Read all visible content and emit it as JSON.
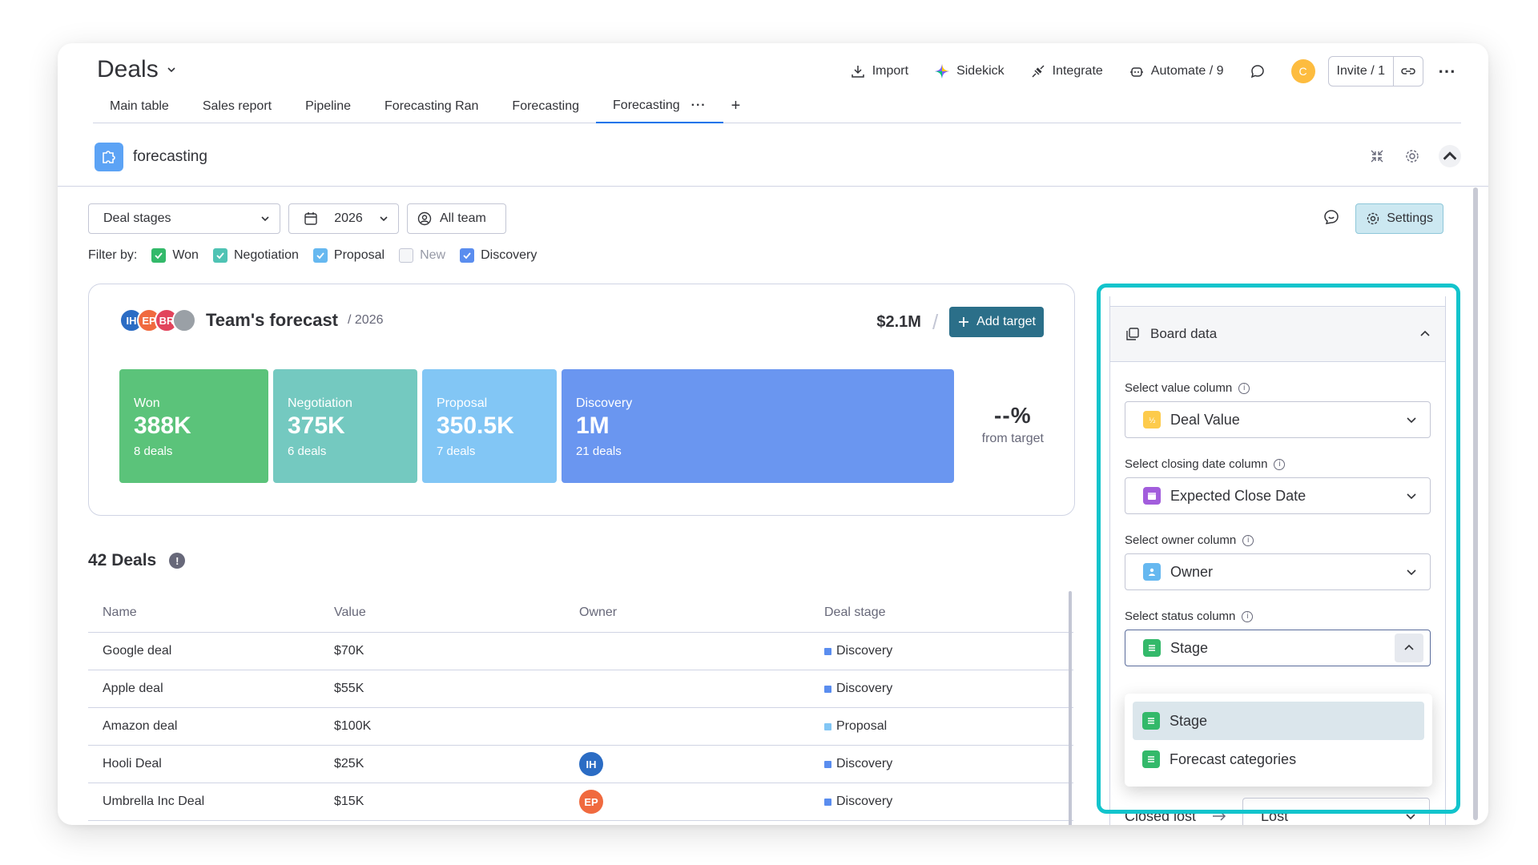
{
  "header": {
    "board_title": "Deals",
    "actions": [
      {
        "label": "Import",
        "icon": "import-icon"
      },
      {
        "label": "Sidekick",
        "icon": "sidekick-icon"
      },
      {
        "label": "Integrate",
        "icon": "integrate-icon"
      },
      {
        "label": "Automate / 9",
        "icon": "automate-icon"
      }
    ],
    "avatar_initial": "C",
    "invite_label": "Invite / 1"
  },
  "tabs": [
    {
      "label": "Main table"
    },
    {
      "label": "Sales report"
    },
    {
      "label": "Pipeline"
    },
    {
      "label": "Forecasting Ran"
    },
    {
      "label": "Forecasting"
    },
    {
      "label": "Forecasting",
      "active": true
    }
  ],
  "widget": {
    "title": "forecasting"
  },
  "filters": {
    "stages_label": "Deal stages",
    "year_label": "2026",
    "team_label": "All team",
    "settings_label": "Settings",
    "filter_by_label": "Filter by:",
    "checks": [
      {
        "label": "Won",
        "checked": true,
        "color": "#33b96a"
      },
      {
        "label": "Negotiation",
        "checked": true,
        "color": "#4fc3b4"
      },
      {
        "label": "Proposal",
        "checked": true,
        "color": "#66b8f0"
      },
      {
        "label": "New",
        "checked": false,
        "color": "#c3c6d4"
      },
      {
        "label": "Discovery",
        "checked": true,
        "color": "#5a8def"
      }
    ]
  },
  "forecast": {
    "title": "Team's forecast",
    "year": "/ 2026",
    "total": "$2.1M",
    "add_target_label": "Add target",
    "avatars": [
      {
        "initials": "IH",
        "color": "#2b6cc4"
      },
      {
        "initials": "EP",
        "color": "#f06a3f"
      },
      {
        "initials": "BR",
        "color": "#e2445c"
      },
      {
        "initials": "",
        "color": "#9aa0a6"
      }
    ],
    "bars": [
      {
        "label": "Won",
        "value": "388K",
        "deals": "8 deals",
        "color": "#5bc37a",
        "width": 150
      },
      {
        "label": "Negotiation",
        "value": "375K",
        "deals": "6 deals",
        "color": "#74c9c0",
        "width": 145
      },
      {
        "label": "Proposal",
        "value": "350.5K",
        "deals": "7 deals",
        "color": "#82c6f5",
        "width": 135
      },
      {
        "label": "Discovery",
        "value": "1M",
        "deals": "21 deals",
        "color": "#6a96f0",
        "width": 397
      }
    ],
    "pct_value": "--%",
    "pct_label": "from target"
  },
  "deals": {
    "title": "42 Deals",
    "columns": [
      "Name",
      "Value",
      "Owner",
      "Deal stage"
    ],
    "rows": [
      {
        "name": "Google deal",
        "value": "$70K",
        "owner": "",
        "owner_color": "",
        "stage": "Discovery",
        "stage_color": "#5a8def"
      },
      {
        "name": "Apple deal",
        "value": "$55K",
        "owner": "",
        "owner_color": "",
        "stage": "Discovery",
        "stage_color": "#5a8def"
      },
      {
        "name": "Amazon deal",
        "value": "$100K",
        "owner": "",
        "owner_color": "",
        "stage": "Proposal",
        "stage_color": "#82c6f5"
      },
      {
        "name": "Hooli Deal",
        "value": "$25K",
        "owner": "IH",
        "owner_color": "#2b6cc4",
        "stage": "Discovery",
        "stage_color": "#5a8def"
      },
      {
        "name": "Umbrella Inc Deal",
        "value": "$15K",
        "owner": "EP",
        "owner_color": "#f06a3f",
        "stage": "Discovery",
        "stage_color": "#5a8def"
      }
    ]
  },
  "settings_panel": {
    "section_title": "Board data",
    "value_label": "Select value column",
    "value_selected": "Deal Value",
    "date_label": "Select closing date column",
    "date_selected": "Expected Close Date",
    "owner_label": "Select owner column",
    "owner_selected": "Owner",
    "status_label": "Select status column",
    "status_selected": "Stage",
    "status_options": [
      "Stage",
      "Forecast categories"
    ],
    "closed_lost_label": "Closed lost",
    "closed_lost_value": "Lost"
  },
  "colors": {
    "accent": "#0073ea",
    "highlight_outline": "#12c4cc",
    "add_target_bg": "#2b6f89"
  }
}
